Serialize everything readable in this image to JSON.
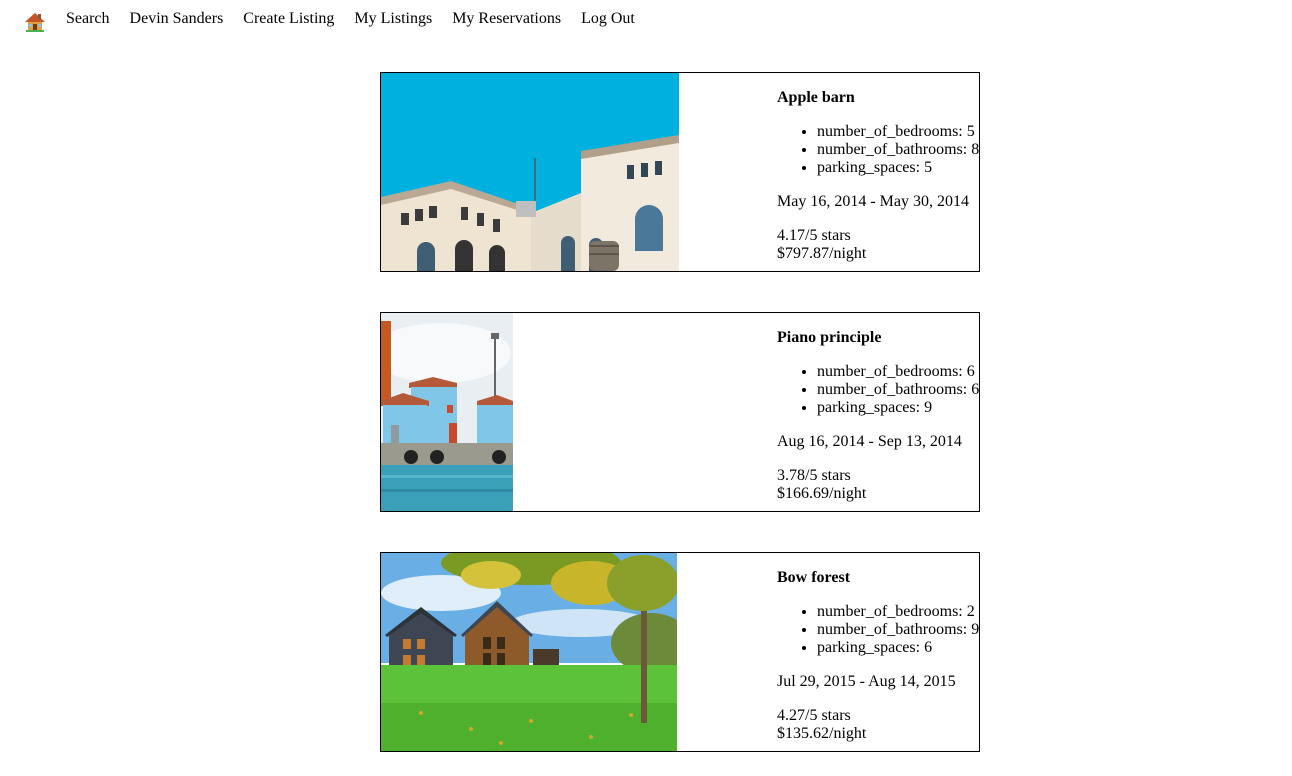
{
  "nav": {
    "home_icon": "house-emoji-icon",
    "links": [
      "Search",
      "Devin Sanders",
      "Create Listing",
      "My Listings",
      "My Reservations",
      "Log Out"
    ]
  },
  "listings": [
    {
      "title": "Apple barn",
      "features": [
        "number_of_bedrooms: 5",
        "number_of_bathrooms: 8",
        "parking_spaces: 5"
      ],
      "dates": "May 16, 2014 - May 30, 2014",
      "rating": "4.17/5 stars",
      "price": "$797.87/night",
      "photo": "white-historic-building-blue-sky"
    },
    {
      "title": "Piano principle",
      "features": [
        "number_of_bedrooms: 6",
        "number_of_bathrooms: 6",
        "parking_spaces: 9"
      ],
      "dates": "Aug 16, 2014 - Sep 13, 2014",
      "rating": "3.78/5 stars",
      "price": "$166.69/night",
      "photo": "blue-building-by-water"
    },
    {
      "title": "Bow forest",
      "features": [
        "number_of_bedrooms: 2",
        "number_of_bathrooms: 9",
        "parking_spaces: 6"
      ],
      "dates": "Jul 29, 2015 - Aug 14, 2015",
      "rating": "4.27/5 stars",
      "price": "$135.62/night",
      "photo": "modern-houses-in-autumn-park"
    }
  ],
  "colors": {
    "sky_blue": "#00b0df",
    "water": "#3a9fb8",
    "grass": "#5cc23a"
  }
}
